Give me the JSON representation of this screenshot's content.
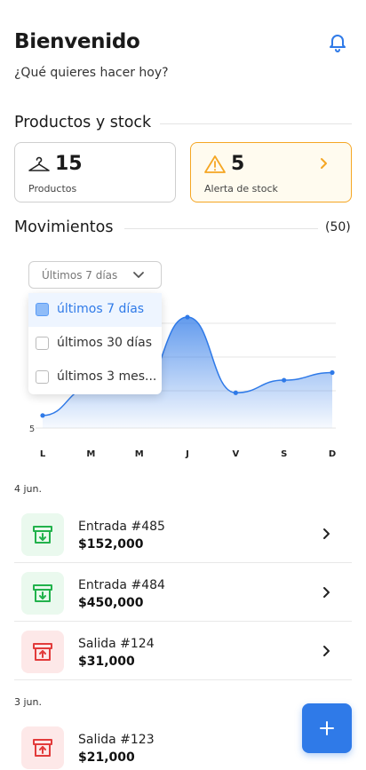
{
  "header": {
    "title": "Bienvenido",
    "subtitle": "¿Qué quieres hacer hoy?"
  },
  "products_section": {
    "title": "Productos y stock",
    "products": {
      "count": "15",
      "label": "Productos",
      "icon": "hanger-icon"
    },
    "alert": {
      "count": "5",
      "label": "Alerta de stock",
      "icon": "warning-icon",
      "accent": "#f5a623"
    }
  },
  "movements": {
    "title": "Movimientos",
    "count": "(50)",
    "range": {
      "selected": "Últimos 7 días",
      "options": [
        "últimos 7 días",
        "últimos 30 días",
        "últimos 3 mes..."
      ]
    }
  },
  "chart_data": {
    "type": "area",
    "categories": [
      "L",
      "M",
      "M",
      "J",
      "V",
      "S",
      "D"
    ],
    "values": [
      5.5,
      6.6,
      6.6,
      9.4,
      6.4,
      6.9,
      7.2
    ],
    "y_tick_labels": [
      "5"
    ],
    "ylim": [
      5,
      10
    ],
    "color": "#2f7ae8",
    "grid": true
  },
  "groups": [
    {
      "date": "4 jun.",
      "items": [
        {
          "title": "Entrada #485",
          "amount": "$152,000",
          "kind": "in"
        },
        {
          "title": "Entrada #484",
          "amount": "$450,000",
          "kind": "in"
        },
        {
          "title": "Salida #124",
          "amount": "$31,000",
          "kind": "out"
        }
      ]
    },
    {
      "date": "3 jun.",
      "items": [
        {
          "title": "Salida #123",
          "amount": "$21,000",
          "kind": "out"
        }
      ]
    }
  ],
  "colors": {
    "primary": "#2f7ae8",
    "in": "#22b24c",
    "out": "#e23b3b"
  }
}
